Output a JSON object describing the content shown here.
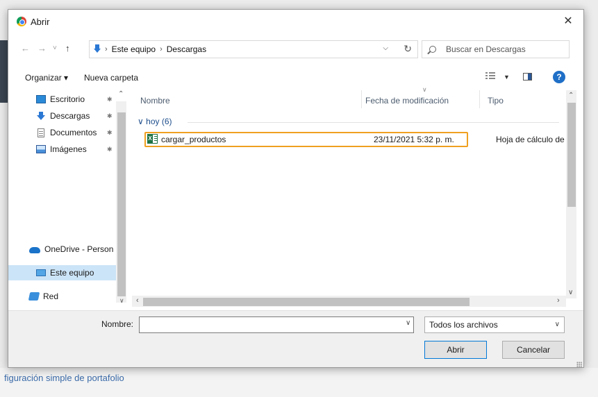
{
  "window": {
    "title": "Abrir",
    "close_glyph": "✕"
  },
  "nav": {
    "back_glyph": "←",
    "forward_glyph": "→",
    "recent_glyph": "˅",
    "up_glyph": "↑",
    "breadcrumb": [
      "Este equipo",
      "Descargas"
    ],
    "crumb_separator": "›",
    "dropdown_glyph": "⌵",
    "refresh_glyph": "↻",
    "search_placeholder": "Buscar en Descargas"
  },
  "toolbar": {
    "organize_label": "Organizar ▾",
    "new_folder_label": "Nueva carpeta",
    "view_drop_glyph": "▼",
    "help_glyph": "?"
  },
  "sidebar": {
    "items": [
      {
        "label": "Escritorio",
        "icon": "desktop-icon",
        "pinned": true
      },
      {
        "label": "Descargas",
        "icon": "download-folder-icon",
        "pinned": true
      },
      {
        "label": "Documentos",
        "icon": "documents-icon",
        "pinned": true
      },
      {
        "label": "Imágenes",
        "icon": "images-icon",
        "pinned": true
      },
      {
        "label": "OneDrive - Person",
        "icon": "onedrive-icon",
        "pinned": false
      },
      {
        "label": "Este equipo",
        "icon": "this-pc-icon",
        "pinned": false,
        "selected": true
      },
      {
        "label": "Red",
        "icon": "network-icon",
        "pinned": false
      }
    ],
    "pin_glyph": "📌"
  },
  "filelist": {
    "columns": [
      "Nombre",
      "Fecha de modificación",
      "Tipo"
    ],
    "group": {
      "label": "hoy (6)",
      "toggle_glyph": "∨"
    },
    "rows": [
      {
        "name": "cargar_productos",
        "modified": "23/11/2021 5:32 p. m.",
        "type": "Hoja de cálculo de",
        "icon": "excel-file-icon"
      }
    ]
  },
  "footer": {
    "filename_label": "Nombre:",
    "filename_value": "",
    "filter_value": "Todos los archivos",
    "open_label": "Abrir",
    "cancel_label": "Cancelar"
  },
  "background": {
    "bottom_text": "figuración simple de portafolio"
  },
  "colors": {
    "accent": "#0078d7",
    "selection": "#cce4f7",
    "highlight_box": "#f0a020",
    "help": "#1f6fc7"
  }
}
